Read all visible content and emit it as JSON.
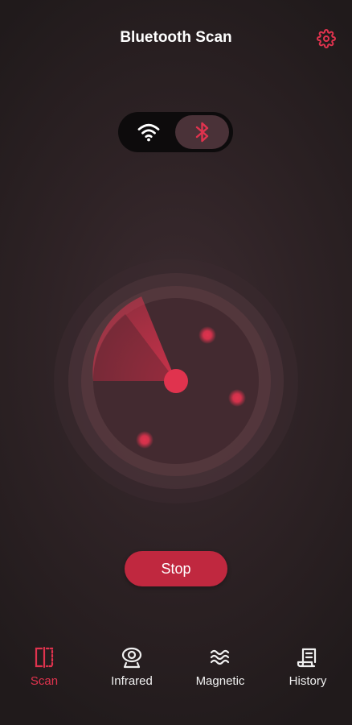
{
  "header": {
    "title": "Bluetooth Scan",
    "settings_icon": "gear-icon"
  },
  "mode_toggle": {
    "options": [
      "wifi",
      "bluetooth"
    ],
    "selected": "bluetooth"
  },
  "radar": {
    "detected_devices": 3
  },
  "action_button": {
    "label": "Stop"
  },
  "tabs": [
    {
      "label": "Scan",
      "icon": "scan-icon",
      "active": true
    },
    {
      "label": "Infrared",
      "icon": "camera-icon",
      "active": false
    },
    {
      "label": "Magnetic",
      "icon": "waves-icon",
      "active": false
    },
    {
      "label": "History",
      "icon": "receipt-icon",
      "active": false
    }
  ],
  "colors": {
    "accent": "#e0334e",
    "button": "#c0283f",
    "background": "#2a2023"
  }
}
